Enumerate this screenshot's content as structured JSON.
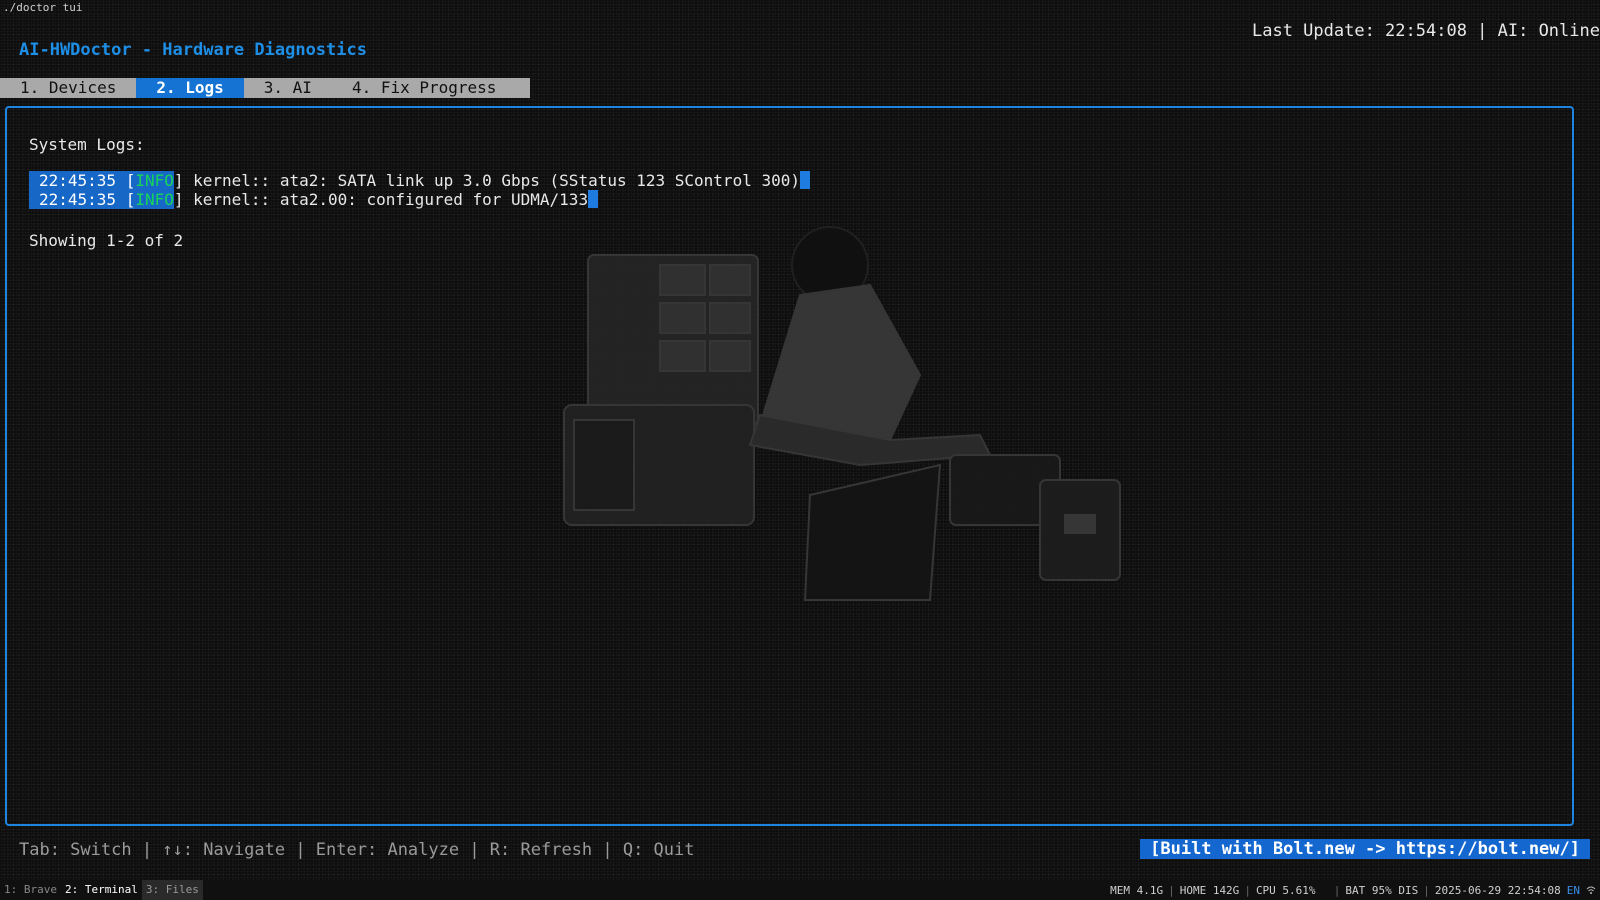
{
  "terminal": {
    "title": "./doctor tui"
  },
  "header": {
    "app_title": "AI-HWDoctor - Hardware Diagnostics",
    "last_update": "Last Update: 22:54:08 | AI: Online"
  },
  "tabs": [
    {
      "label": "1. Devices",
      "active": false
    },
    {
      "label": "2. Logs",
      "active": true
    },
    {
      "label": "3. AI",
      "active": false
    },
    {
      "label": "4. Fix Progress",
      "active": false
    }
  ],
  "logs": {
    "heading": "System Logs:",
    "entries": [
      {
        "time": "22:45:35",
        "level": "INFO",
        "message": "kernel:: ata2: SATA link up 3.0 Gbps (SStatus 123 SControl 300)"
      },
      {
        "time": "22:45:35",
        "level": "INFO",
        "message": "kernel:: ata2.00: configured for UDMA/133"
      }
    ],
    "showing": "Showing 1-2 of 2"
  },
  "footer": {
    "help": "Tab: Switch | ↑↓: Navigate | Enter: Analyze | R: Refresh | Q: Quit",
    "badge": "[Built with Bolt.new -> https://bolt.new/]"
  },
  "statusbar": {
    "workspaces": [
      {
        "label": "1: Brave",
        "state": "inactive"
      },
      {
        "label": "2: Terminal",
        "state": "active"
      },
      {
        "label": "3: Files",
        "state": "dim"
      }
    ],
    "mem": "MEM 4.1G",
    "home": "HOME 142G",
    "cpu": "CPU 5.61%",
    "bat": "BAT 95% DIS",
    "datetime": "2025-06-29 22:54:08",
    "lang": "EN"
  },
  "colors": {
    "accent": "#1e84e0",
    "highlight": "#1667c6",
    "info": "#16d45a"
  }
}
